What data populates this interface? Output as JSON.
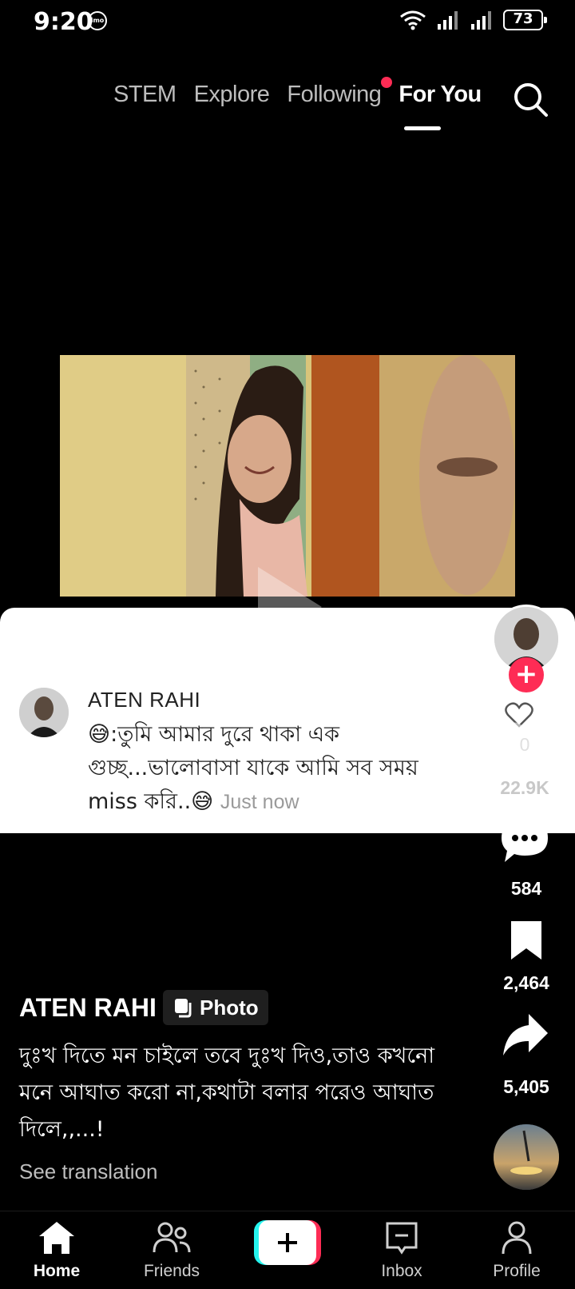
{
  "status_bar": {
    "time": "9:20",
    "app_badge": "imo",
    "battery": "73"
  },
  "top_nav": {
    "tabs": [
      {
        "label": "STEM"
      },
      {
        "label": "Explore"
      },
      {
        "label": "Following"
      },
      {
        "label": "For You"
      }
    ],
    "active_tab": "For You"
  },
  "comment": {
    "author": "ATEN RAHI",
    "text": "😅:তুমি আমার দুরে থাকা এক গুচ্ছ...ভালোবাসা যাকে আমি সব সময় miss করি..😅",
    "time": "Just now"
  },
  "actions": {
    "likes": "22.9K",
    "comments": "584",
    "saves": "2,464",
    "shares": "5,405",
    "like_overlay": "0"
  },
  "post": {
    "author": "ATEN RAHI",
    "type_badge": "Photo",
    "caption": "দুঃখ দিতে মন চাইলে তবে দুঃখ দিও,তাও কখনো মনে আঘাত করো না,কথাটা বলার পরেও আঘাত দিলে,,...!",
    "see_translation": "See translation"
  },
  "bottom_nav": {
    "items": [
      {
        "label": "Home"
      },
      {
        "label": "Friends"
      },
      {
        "label": "Inbox"
      },
      {
        "label": "Profile"
      }
    ]
  },
  "colors": {
    "accent": "#fe2c55",
    "background": "#000000",
    "card": "#ffffff"
  }
}
